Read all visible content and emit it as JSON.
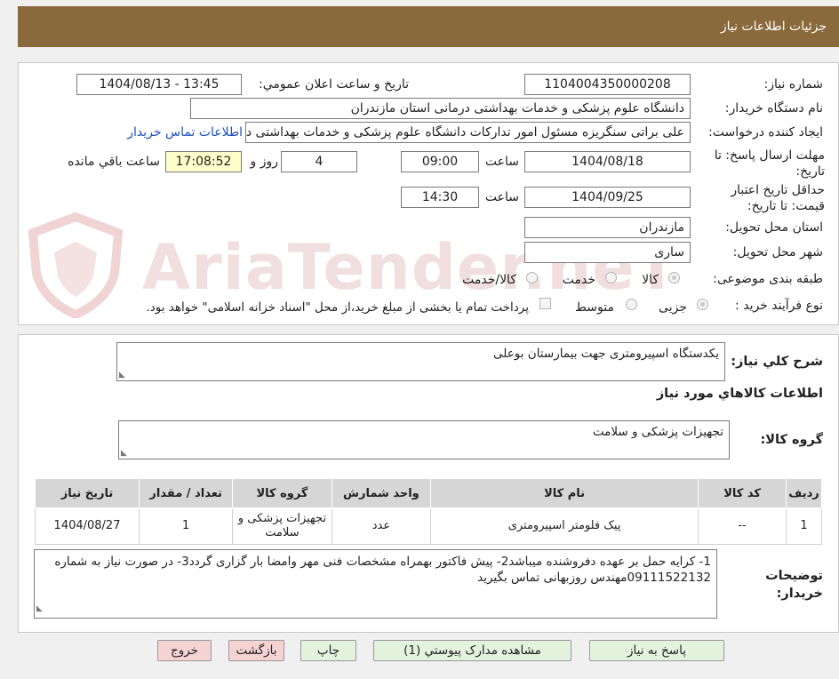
{
  "header": {
    "title": "جزئیات اطلاعات نیاز"
  },
  "colors": {
    "header_bg": "#8a6a3c",
    "header_text": "#ffffff",
    "link": "#1a4ec2",
    "highlight_field": "#ffffcc",
    "watermark": "#f1d9d9"
  },
  "watermark": {
    "text": "AriaTender.neT"
  },
  "form": {
    "need_number": {
      "label": "شماره نیاز:",
      "value": "1104004350000208"
    },
    "announce": {
      "label": "تاریخ و ساعت اعلان عمومي:",
      "value": "1404/08/13 - 13:45"
    },
    "buyer_org": {
      "label": "نام دستگاه خریدار:",
      "value": "دانشگاه علوم پزشکی و خدمات بهداشتی  درمانی استان مازندران"
    },
    "requester": {
      "label": "ایجاد کننده درخواست:",
      "value": "علی براتی سنگریزه مسئول امور تدارکات دانشگاه علوم پزشکی و خدمات بهداشتی درمانی",
      "contact_link": "اطلاعات تماس خریدار"
    },
    "deadline": {
      "label": "مهلت ارسال پاسخ: تا تاریخ:",
      "date": "1404/08/18",
      "time_label": "ساعت",
      "time": "09:00",
      "days": "4",
      "days_label": "روز و",
      "remaining": "17:08:52",
      "remaining_label": "ساعت باقي مانده"
    },
    "validity": {
      "label": "حداقل تاریخ اعتبار قیمت: تا تاریخ:",
      "date": "1404/09/25",
      "time_label": "ساعت",
      "time": "14:30"
    },
    "province": {
      "label": "استان محل تحویل:",
      "value": "مازندران"
    },
    "city": {
      "label": "شهر محل تحویل:",
      "value": "ساری"
    },
    "category": {
      "label": "طبقه بندی موضوعی:",
      "options": [
        "کالا",
        "خدمت",
        "کالا/خدمت"
      ]
    },
    "process": {
      "label": "نوع فرآیند خرید :",
      "options": [
        "جزیی",
        "متوسط"
      ],
      "note": "پرداخت تمام یا بخشی از مبلغ خرید،از محل \"اسناد خزانه اسلامی\" خواهد بود."
    }
  },
  "description": {
    "label": "شرح کلي نیاز:",
    "value": "یکدستگاه اسپیرومتری جهت بیمارستان بوعلی"
  },
  "goods": {
    "section_title": "اطلاعات كالاهاي مورد نیاز",
    "group_label": "گروه کالا:",
    "group_value": "تجهیزات پزشکی و سلامت",
    "table": {
      "headers": [
        "ردیف",
        "کد کالا",
        "نام کالا",
        "واحد شمارش",
        "گروه کالا",
        "تعداد / مقدار",
        "تاریخ نیاز"
      ],
      "rows": [
        [
          "1",
          "--",
          "پیک فلومتر اسپیرومتری",
          "عدد",
          "تجهیزات پزشکی و سلامت",
          "1",
          "1404/08/27"
        ]
      ]
    }
  },
  "buyer_notes": {
    "label": "توضیحات خریدار:",
    "value": "1- کرایه حمل بر عهده دفروشنده میباشد2- پیش فاکتور بهمراه مشخصات فنی مهر وامضا بار گزاری گردد3- در صورت نیاز به شماره 09111522132مهندس روزبهانی تماس بگیرید"
  },
  "buttons": {
    "reply": "پاسخ به نیاز",
    "attachments": "مشاهده مدارک پیوستي (1)",
    "print": "چاپ",
    "back": "بازگشت",
    "exit": "خروج"
  }
}
